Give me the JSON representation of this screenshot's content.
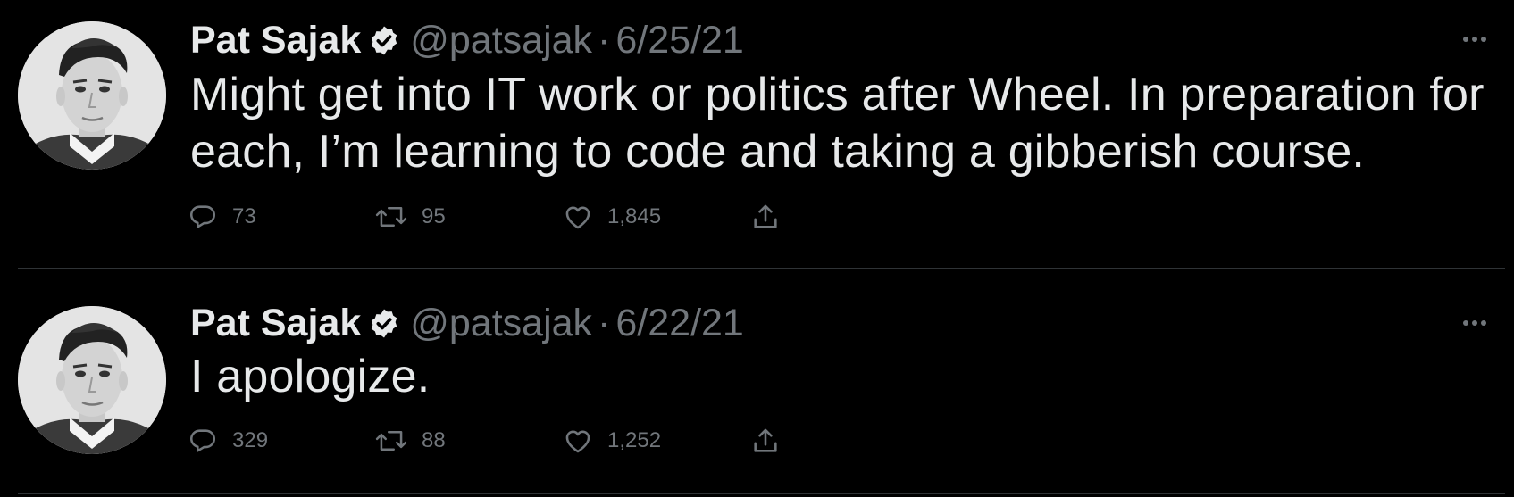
{
  "tweets": [
    {
      "display_name": "Pat Sajak",
      "handle": "@patsajak",
      "separator": "·",
      "date": "6/25/21",
      "text": "Might get into IT work or politics after Wheel. In preparation for each, I’m learning to code and taking a gibberish course.",
      "replies": "73",
      "retweets": "95",
      "likes": "1,845"
    },
    {
      "display_name": "Pat Sajak",
      "handle": "@patsajak",
      "separator": "·",
      "date": "6/22/21",
      "text": "I apologize.",
      "replies": "329",
      "retweets": "88",
      "likes": "1,252"
    }
  ],
  "icons": {
    "verified": "verified-badge-icon",
    "more": "more-options-icon",
    "reply": "reply-icon",
    "retweet": "retweet-icon",
    "like": "heart-icon",
    "share": "share-icon"
  },
  "colors": {
    "background": "#000000",
    "primary_text": "#e7e9ea",
    "secondary_text": "#71767b",
    "divider": "#2f3336"
  }
}
